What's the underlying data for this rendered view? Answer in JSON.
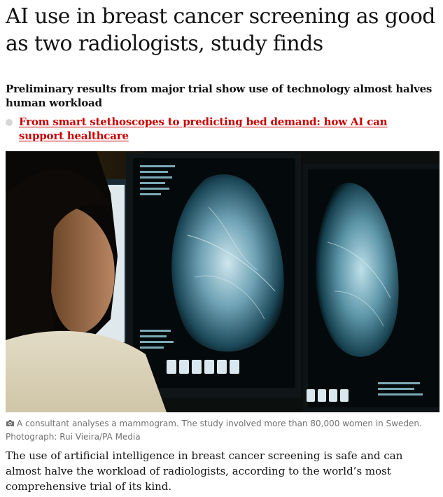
{
  "article": {
    "headline": "AI use in breast cancer screening as good as two radiologists, study finds",
    "standfirst": "Preliminary results from major trial show use of technology almost halves human workload",
    "related_link": "From smart stethoscopes to predicting bed demand: how AI can support healthcare",
    "caption": "A consultant analyses a mammogram. The study involved more than 80,000 women in Sweden. Photograph: Rui Vieira/PA Media",
    "body": "The use of artificial intelligence in breast cancer screening is safe and can almost halve the workload of radiologists, according to the world’s most comprehensive trial of its kind."
  },
  "icons": {
    "bullet": "dot-icon",
    "caption": "camera-icon"
  },
  "colors": {
    "link": "#c70000",
    "text": "#121212",
    "caption": "#707070",
    "bullet": "#d6d6d6"
  }
}
